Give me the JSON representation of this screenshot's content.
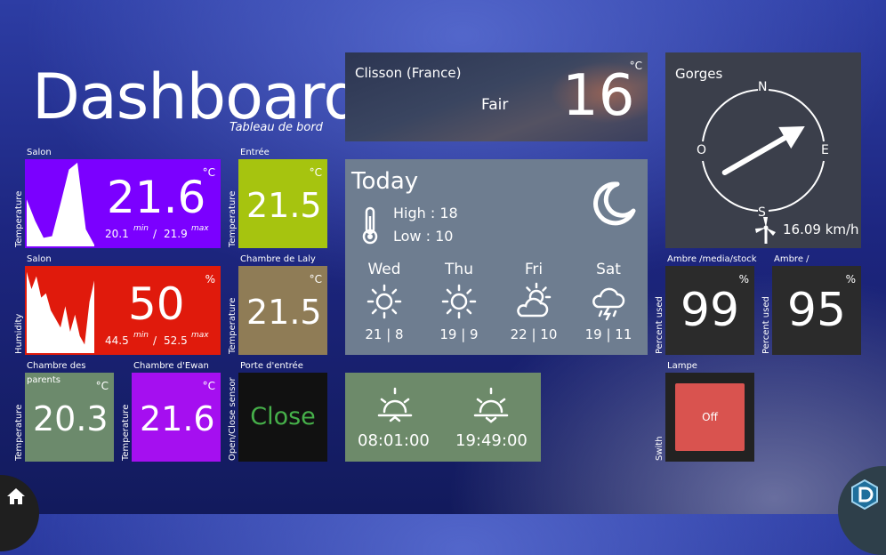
{
  "header": {
    "title": "Dashboard",
    "subtitle": "Tableau de bord"
  },
  "tiles": {
    "salon_temp": {
      "room": "Salon",
      "type": "Temperature",
      "value": "21.6",
      "unit": "°C",
      "min": "20.1",
      "min_label": "min",
      "sep": "/",
      "max": "21.9",
      "max_label": "max",
      "color": "#7b00ff"
    },
    "entree_temp": {
      "room": "Entrée",
      "type": "Temperature",
      "value": "21.5",
      "unit": "°C",
      "color": "#a6c40f"
    },
    "salon_hum": {
      "room": "Salon",
      "type": "Humidity",
      "value": "50",
      "unit": "%",
      "min": "44.5",
      "min_label": "min",
      "sep": "/",
      "max": "52.5",
      "max_label": "max",
      "color": "#e01a0c"
    },
    "laly_temp": {
      "room": "Chambre de Laly",
      "type": "Temperature",
      "value": "21.5",
      "unit": "°C",
      "color": "#8f7c56"
    },
    "parents_temp": {
      "room_line1": "Chambre des",
      "room_line2": "parents",
      "type": "Temperature",
      "value": "20.3",
      "unit": "°C",
      "color": "#6c8a6c"
    },
    "ewan_temp": {
      "room": "Chambre d'Ewan",
      "type": "Temperature",
      "value": "21.6",
      "unit": "°C",
      "color": "#a50ff0"
    },
    "porte": {
      "room": "Porte d'entrée",
      "type": "Open/Close sensor",
      "value": "Close",
      "color": "#111111",
      "value_color": "#46b04a"
    }
  },
  "weather_now": {
    "city": "Clisson (France)",
    "condition": "Fair",
    "temp": "16",
    "unit": "°C"
  },
  "forecast": {
    "title": "Today",
    "high_label": "High : 18",
    "low_label": "Low : 10",
    "days": [
      {
        "name": "Wed",
        "range": "21 | 8",
        "icon": "sun-icon"
      },
      {
        "name": "Thu",
        "range": "19 | 9",
        "icon": "sun-icon"
      },
      {
        "name": "Fri",
        "range": "22 | 10",
        "icon": "partly-cloudy-icon"
      },
      {
        "name": "Sat",
        "range": "19 | 11",
        "icon": "storm-icon"
      }
    ]
  },
  "sun": {
    "sunrise": "08:01:00",
    "sunset": "19:49:00"
  },
  "wind": {
    "place": "Gorges",
    "speed": "16.09 km/h",
    "north": "N",
    "east": "E",
    "south": "S",
    "west": "O",
    "bearing_deg": 60
  },
  "storage": [
    {
      "label": "Ambre /media/stock",
      "type": "Percent used",
      "value": "99",
      "unit": "%"
    },
    {
      "label": "Ambre /",
      "type": "Percent used",
      "value": "95",
      "unit": "%"
    }
  ],
  "switch": {
    "label": "Lampe",
    "type": "Swith",
    "state": "Off"
  },
  "colors": {
    "tile_dark": "#2b2b2b",
    "weather_tile": "#6e7d90",
    "sun_tile": "#6d8a6a",
    "switch_red": "#d9534f"
  },
  "charts": {
    "salon_temp_series": [
      0.55,
      0.3,
      0.1,
      0.12,
      0.5,
      0.9,
      0.98,
      0.2,
      0.02
    ],
    "salon_hum_series": [
      0.95,
      0.75,
      0.9,
      0.65,
      0.7,
      0.5,
      0.4,
      0.3,
      0.55,
      0.25,
      0.45,
      0.2,
      0.1,
      0.6,
      0.85
    ]
  }
}
